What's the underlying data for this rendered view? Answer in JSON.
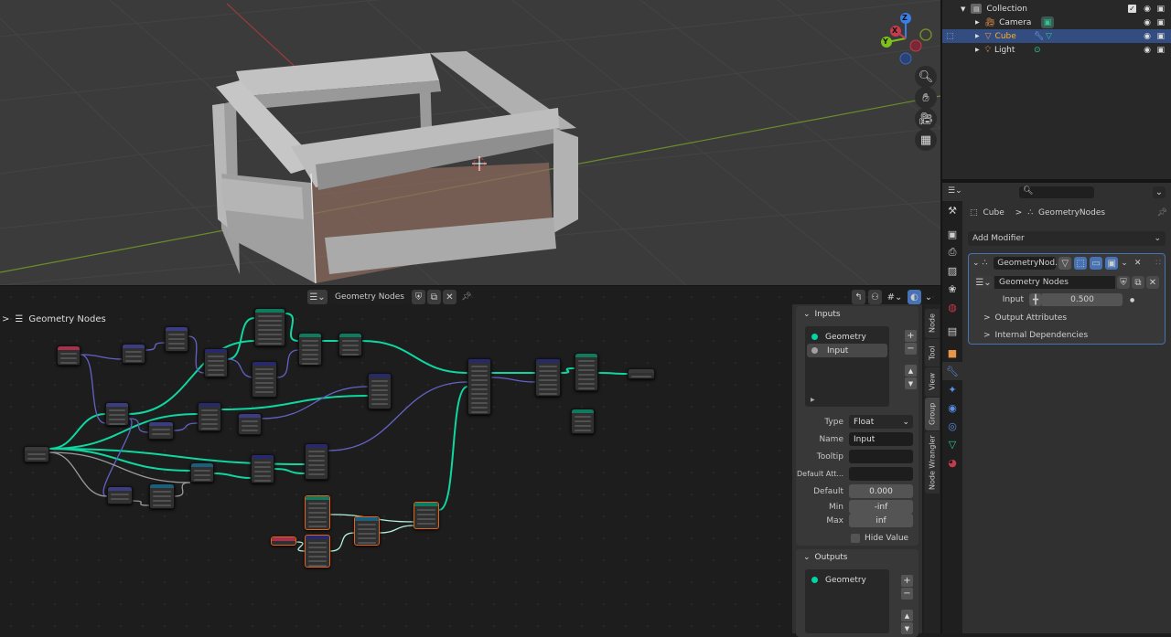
{
  "outliner": {
    "collection": "Collection",
    "items": [
      {
        "label": "Camera",
        "icon": "camera-icon",
        "color": "#e8954a"
      },
      {
        "label": "Cube",
        "icon": "mesh-icon",
        "color": "#e8954a",
        "selected": true
      },
      {
        "label": "Light",
        "icon": "light-icon",
        "color": "#e8954a"
      }
    ]
  },
  "properties": {
    "search_placeholder": "",
    "breadcrumb": {
      "object": "Cube",
      "modifier": "GeometryNodes"
    },
    "add_modifier": "Add Modifier",
    "modifier": {
      "name": "GeometryNod...",
      "node_group": "Geometry Nodes",
      "input_label": "Input",
      "input_value": "0.500",
      "output_attributes": "Output Attributes",
      "internal_dependencies": "Internal Dependencies"
    }
  },
  "node_editor": {
    "node_group": "Geometry Nodes",
    "breadcrumb": "Geometry Nodes",
    "sidebar_tabs": [
      "Node",
      "Tool",
      "View",
      "Group",
      "Node Wrangler"
    ],
    "active_tab": "Group",
    "inputs": {
      "title": "Inputs",
      "items": [
        {
          "label": "Geometry",
          "color": "#00d6a3"
        },
        {
          "label": "Input",
          "color": "#a1a1a1",
          "active": true
        }
      ],
      "type_label": "Type",
      "type_value": "Float",
      "name_label": "Name",
      "name_value": "Input",
      "tooltip_label": "Tooltip",
      "tooltip_value": "",
      "default_attr_label": "Default Att...",
      "default_attr_value": "",
      "default_label": "Default",
      "default_value": "0.000",
      "min_label": "Min",
      "min_value": "-inf",
      "max_label": "Max",
      "max_value": "inf",
      "hide_value_label": "Hide Value"
    },
    "outputs": {
      "title": "Outputs",
      "items": [
        {
          "label": "Geometry",
          "color": "#00d6a3"
        }
      ]
    }
  },
  "gizmo": {
    "x": "X",
    "y": "Y",
    "z": "Z"
  },
  "colors": {
    "accent": "#4772b3",
    "selected_outline": "#e2641a",
    "geometry_socket": "#00d6a3",
    "float_link": "#6363c7"
  }
}
